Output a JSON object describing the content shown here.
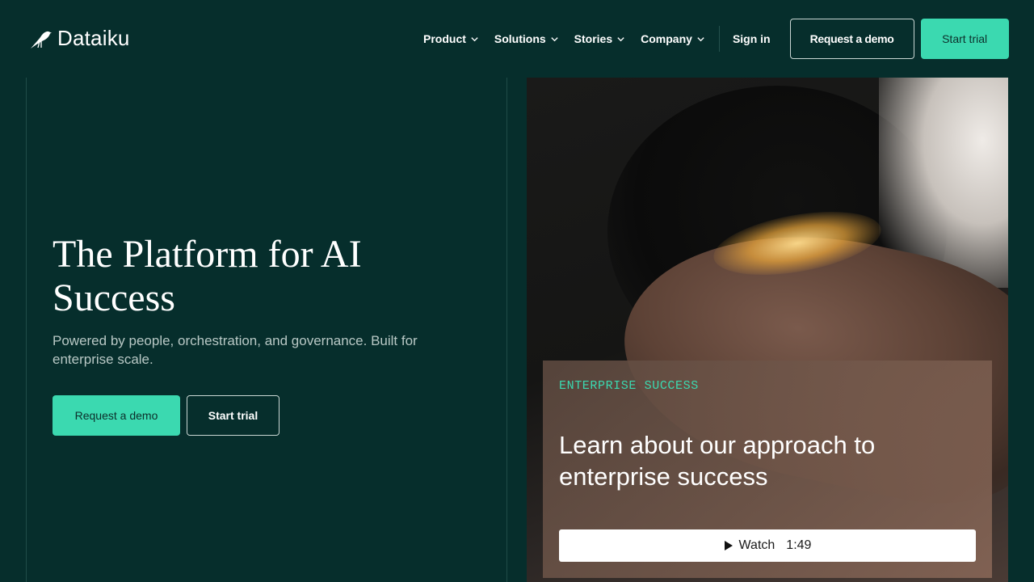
{
  "brand": {
    "name": "Dataiku"
  },
  "nav": {
    "items": [
      {
        "label": "Product"
      },
      {
        "label": "Solutions"
      },
      {
        "label": "Stories"
      },
      {
        "label": "Company"
      }
    ],
    "signin": "Sign in",
    "request_demo": "Request a demo",
    "start_trial": "Start trial"
  },
  "hero": {
    "title": "The Platform for AI Success",
    "subtitle": "Powered by people, orchestration, and governance. Built for enterprise scale.",
    "request_demo": "Request a demo",
    "start_trial": "Start trial"
  },
  "feature_card": {
    "tag": "ENTERPRISE SUCCESS",
    "title": "Learn about our approach to enterprise success",
    "watch_label": "Watch",
    "duration": "1:49"
  },
  "colors": {
    "background": "#062e2c",
    "accent": "#3bd9b0",
    "text": "#ffffff"
  },
  "icons": [
    "dataiku-bird-logo-icon",
    "chevron-down-icon",
    "play-icon"
  ]
}
